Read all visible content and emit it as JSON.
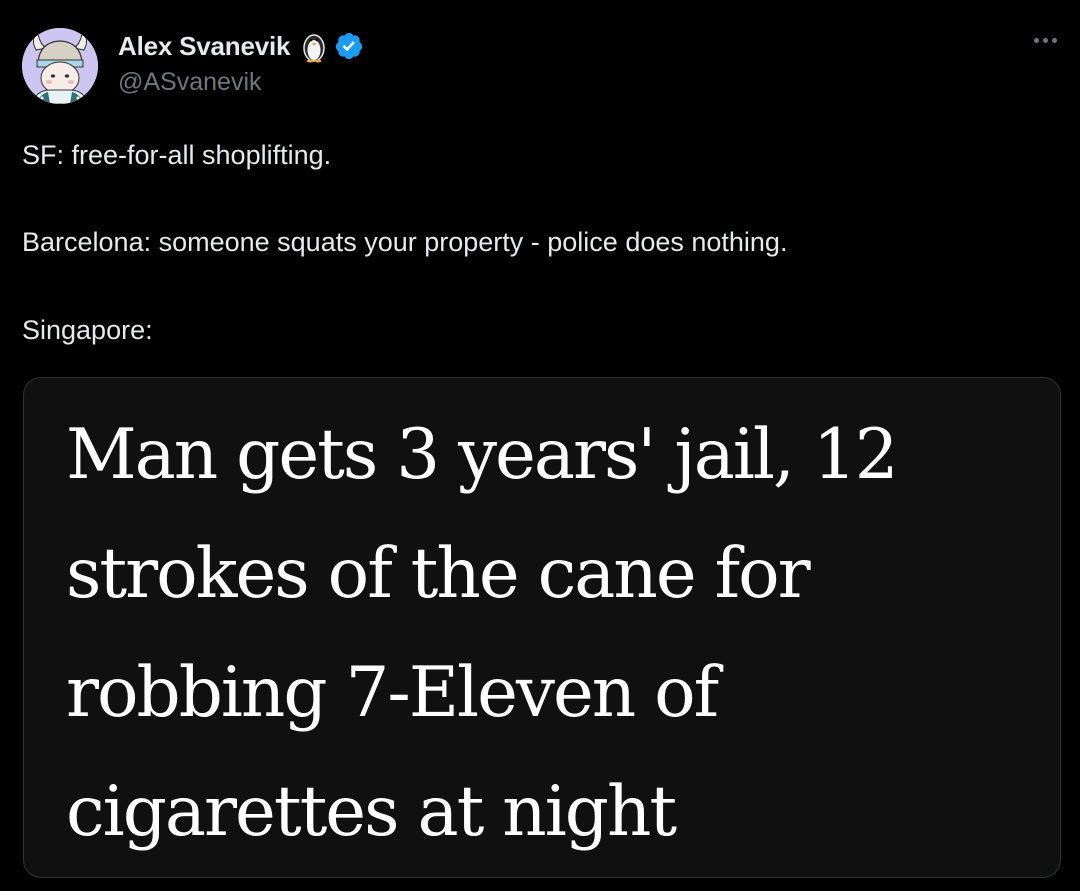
{
  "tweet": {
    "author": {
      "display_name": "Alex Svanevik",
      "handle": "@ASvanevik",
      "badge_icon": "penguin-icon",
      "verified_icon": "verified-badge-icon",
      "verified_color": "#1d9bf0"
    },
    "more_icon": "more-options-icon",
    "text_lines": [
      "SF: free-for-all shoplifting.",
      "Barcelona: someone squats your property - police does nothing.",
      "Singapore:"
    ],
    "media": {
      "headline_lines": [
        "Man gets 3 years' jail, 12",
        "strokes of the cane for",
        "robbing 7-Eleven of",
        "cigarettes at night"
      ]
    }
  },
  "colors": {
    "background": "#000000",
    "text_primary": "#e7e9ea",
    "text_secondary": "#71767b",
    "media_background": "#101010",
    "headline_text": "#ffffff"
  }
}
